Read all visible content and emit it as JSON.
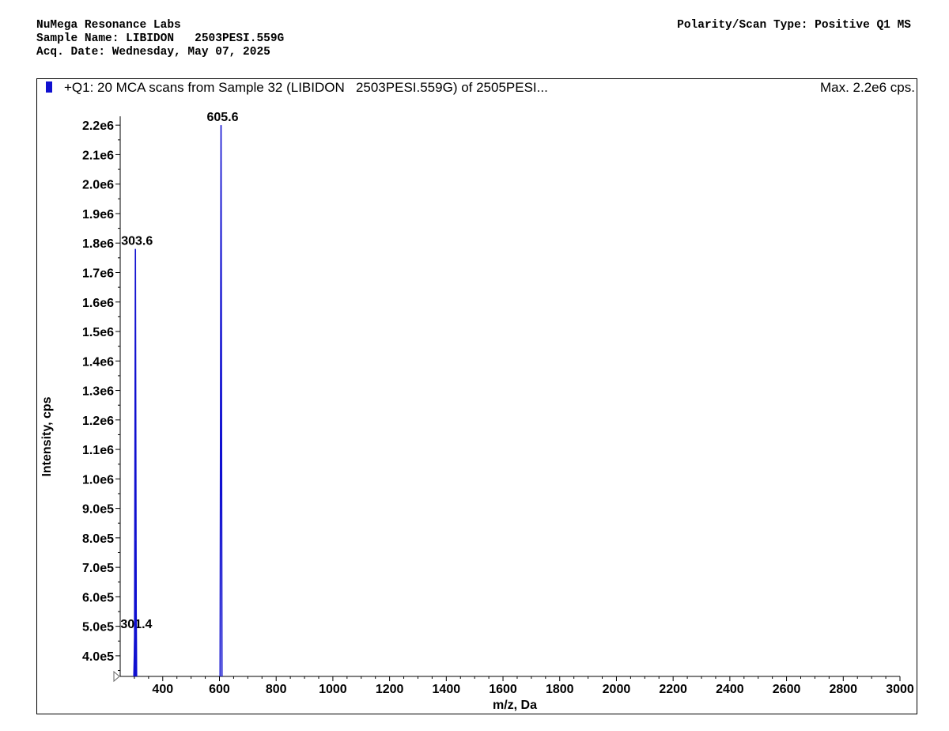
{
  "header": {
    "lab": "NuMega Resonance Labs",
    "sample_name": "Sample Name: LIBIDON   2503PESI.559G",
    "acq_date": "Acq. Date: Wednesday, May 07, 2025",
    "polarity": "Polarity/Scan Type: Positive Q1 MS"
  },
  "chart_data": {
    "type": "line",
    "legend_text": "+Q1: 20 MCA scans from Sample 32 (LIBIDON   2503PESI.559G) of 2505PESI...",
    "max_text": "Max. 2.2e6 cps.",
    "xlabel": "m/z, Da",
    "ylabel": "Intensity, cps",
    "xlim": [
      250,
      3000
    ],
    "ylim": [
      330000,
      2230000
    ],
    "x_ticks": [
      400,
      600,
      800,
      1000,
      1200,
      1400,
      1600,
      1800,
      2000,
      2200,
      2400,
      2600,
      2800,
      3000
    ],
    "y_ticks": [
      {
        "value": 400000,
        "label": "4.0e5"
      },
      {
        "value": 500000,
        "label": "5.0e5"
      },
      {
        "value": 600000,
        "label": "6.0e5"
      },
      {
        "value": 700000,
        "label": "7.0e5"
      },
      {
        "value": 800000,
        "label": "8.0e5"
      },
      {
        "value": 900000,
        "label": "9.0e5"
      },
      {
        "value": 1000000,
        "label": "1.0e6"
      },
      {
        "value": 1100000,
        "label": "1.1e6"
      },
      {
        "value": 1200000,
        "label": "1.2e6"
      },
      {
        "value": 1300000,
        "label": "1.3e6"
      },
      {
        "value": 1400000,
        "label": "1.4e6"
      },
      {
        "value": 1500000,
        "label": "1.5e6"
      },
      {
        "value": 1600000,
        "label": "1.6e6"
      },
      {
        "value": 1700000,
        "label": "1.7e6"
      },
      {
        "value": 1800000,
        "label": "1.8e6"
      },
      {
        "value": 1900000,
        "label": "1.9e6"
      },
      {
        "value": 2000000,
        "label": "2.0e6"
      },
      {
        "value": 2100000,
        "label": "2.1e6"
      },
      {
        "value": 2200000,
        "label": "2.2e6"
      }
    ],
    "series": [
      {
        "color": "#1010d0",
        "peaks": [
          {
            "mz": 301.4,
            "intensity": 480000,
            "label": "301.4"
          },
          {
            "mz": 303.6,
            "intensity": 1780000,
            "label": "303.6"
          },
          {
            "mz": 304.6,
            "intensity": 790000
          },
          {
            "mz": 605.6,
            "intensity": 2200000,
            "label": "605.6"
          }
        ]
      }
    ],
    "grid": false
  }
}
